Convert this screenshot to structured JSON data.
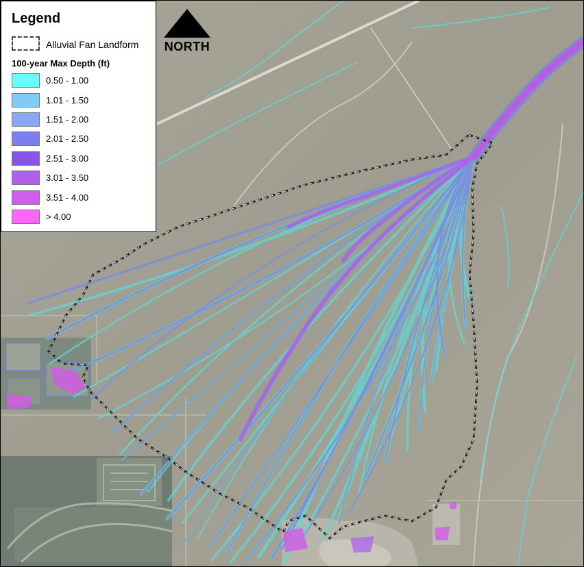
{
  "legend": {
    "title": "Legend",
    "fan_label": "Alluvial Fan Landform",
    "depth_title": "100-year Max Depth (ft)",
    "classes": [
      {
        "label": "0.50 - 1.00",
        "color": "#66ffff"
      },
      {
        "label": "1.01 - 1.50",
        "color": "#80ccf5"
      },
      {
        "label": "1.51 - 2.00",
        "color": "#8aa6f7"
      },
      {
        "label": "2.01 - 2.50",
        "color": "#7a80ee"
      },
      {
        "label": "2.51 - 3.00",
        "color": "#8a55e6"
      },
      {
        "label": "3.01 - 3.50",
        "color": "#b060ec"
      },
      {
        "label": "3.51 - 4.00",
        "color": "#d05cf0"
      },
      {
        "label": "> 4.00",
        "color": "#ff66ff"
      }
    ]
  },
  "north": {
    "label": "NORTH"
  },
  "colors": {
    "terrain": "#a09f92",
    "boundary": "#222222",
    "shallow_flow": "#5fd8d6",
    "mid_flow": "#7f7fe6",
    "deep_flow": "#c255e8"
  }
}
